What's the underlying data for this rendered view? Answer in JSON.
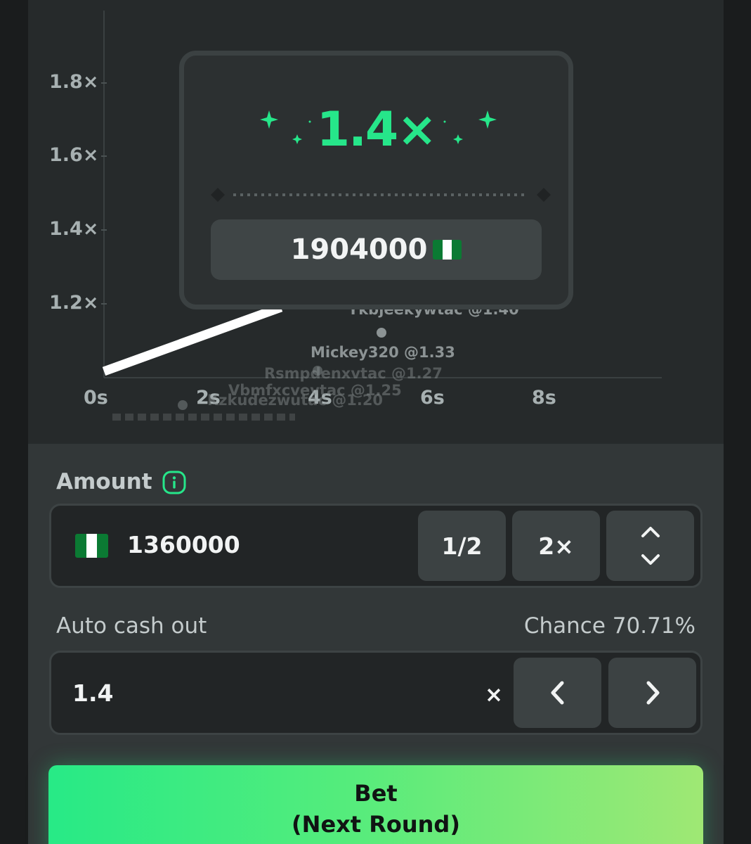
{
  "chart": {
    "y_ticks": [
      "1.8×",
      "1.6×",
      "1.4×",
      "1.2×"
    ],
    "x_ticks": [
      "0s",
      "2s",
      "4s",
      "6s",
      "8s"
    ],
    "players": [
      {
        "label": "Ykbjeekywtac @1.40"
      },
      {
        "label": "Mickey320 @1.33"
      },
      {
        "label": "Rsmpdenxvtac @1.27"
      },
      {
        "label": "Vbmfxcvevtac @1.25"
      },
      {
        "label": "Kzkudezwutac @1.20"
      }
    ],
    "curve_color": "#ffffff"
  },
  "popup": {
    "multiplier": "1.4×",
    "win_amount": "1904000",
    "accent_color": "#26e68a"
  },
  "amount": {
    "label": "Amount",
    "value": "1360000",
    "half_label": "1/2",
    "double_label": "2×",
    "info_icon": "info-icon",
    "flag": "nigeria-flag"
  },
  "auto_cash_out": {
    "label": "Auto cash out",
    "chance": "Chance 70.71%",
    "value": "1.4",
    "suffix": "×"
  },
  "bet_button": {
    "line1": "Bet",
    "line2": "(Next Round)"
  }
}
